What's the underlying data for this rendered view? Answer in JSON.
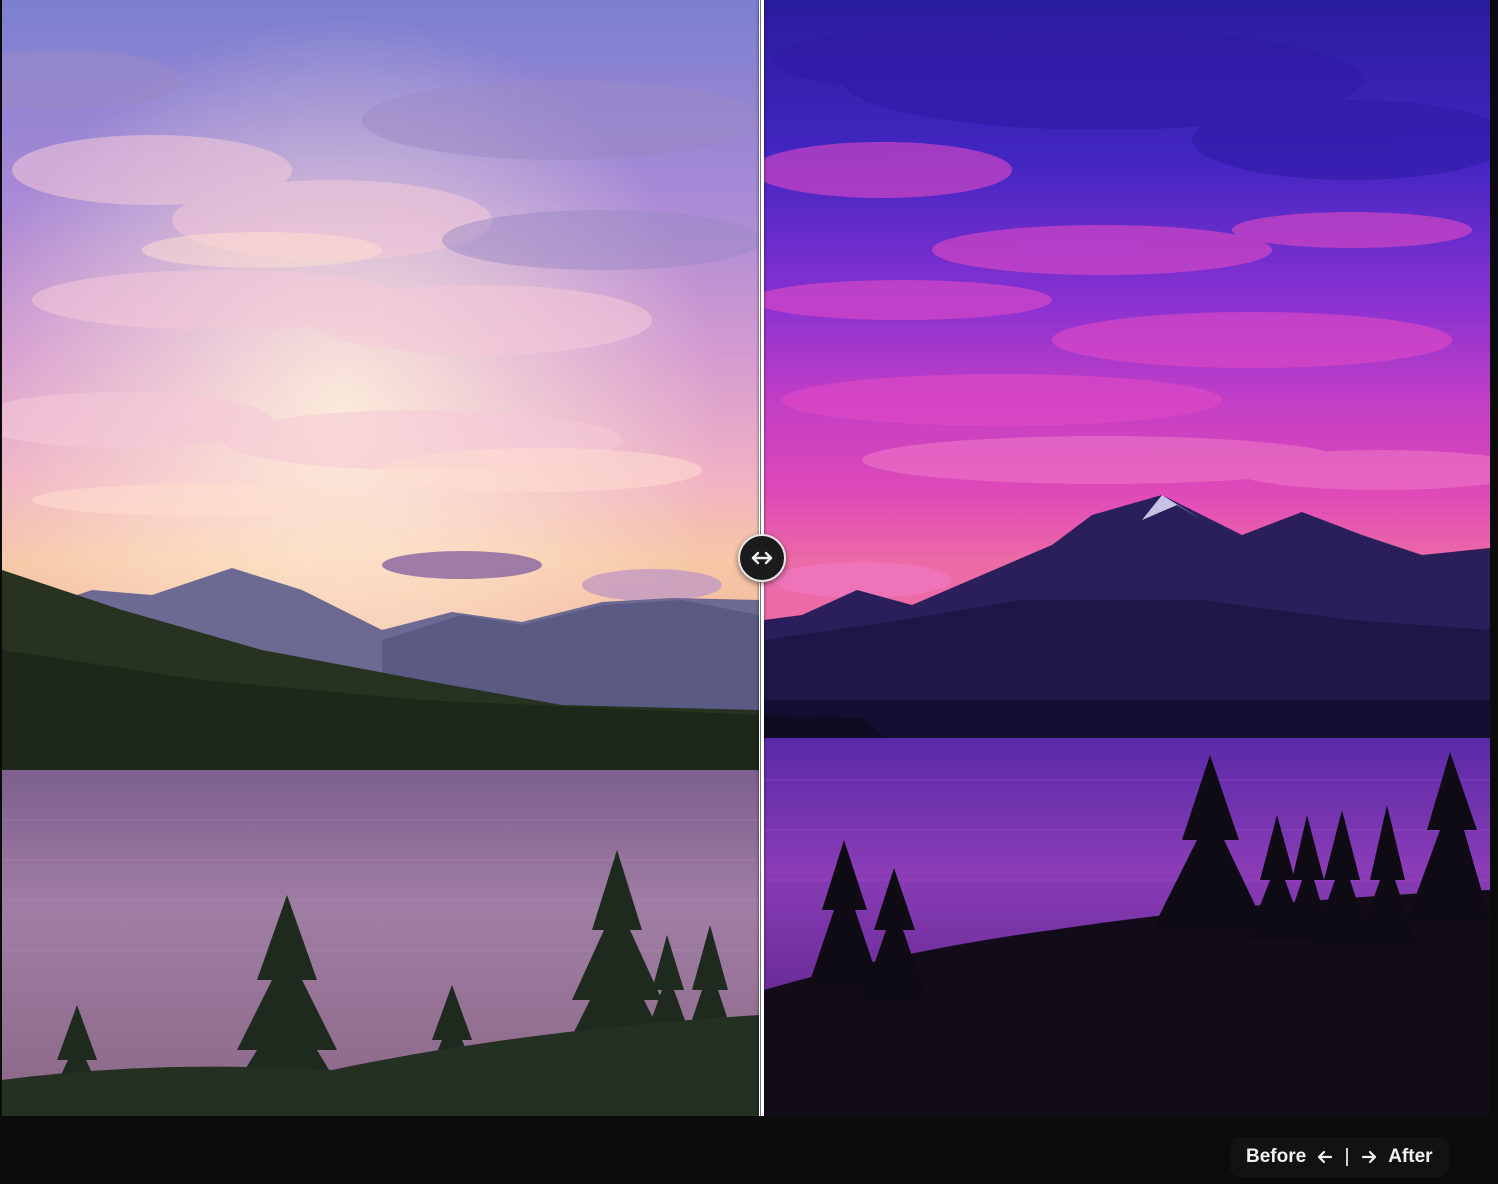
{
  "legend": {
    "before_label": "Before",
    "after_label": "After",
    "left_arrow_icon": "arrow-left-icon",
    "right_arrow_icon": "arrow-right-icon"
  },
  "slider": {
    "handle_icon": "left-right-arrows-icon"
  },
  "colors": {
    "before_sky_top": "#7b7fd0",
    "before_sky_horizon": "#f7c3a0",
    "after_sky_top": "#2a1c9e",
    "after_sky_horizon": "#e04ab8",
    "divider": "#ffffff",
    "bottom_bar": "#0b0b0c"
  }
}
